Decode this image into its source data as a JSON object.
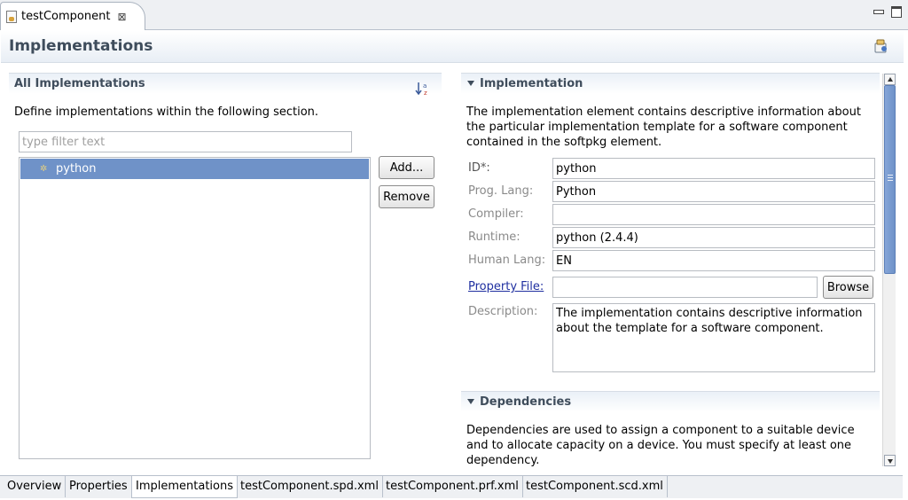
{
  "editor": {
    "tab_title": "testComponent",
    "close_glyph": "⊠"
  },
  "header": {
    "title": "Implementations"
  },
  "left": {
    "section_title": "All Implementations",
    "description": "Define implementations within the following section.",
    "filter_placeholder": "type filter text",
    "filter_value": "",
    "items": [
      {
        "label": "python",
        "icon": "gear-icon",
        "selected": true
      }
    ],
    "add_label": "Add...",
    "remove_label": "Remove"
  },
  "implementation": {
    "section_title": "Implementation",
    "description": "The implementation element contains descriptive information about the particular implementation template for a software component contained in the softpkg element.",
    "fields": {
      "id_label": "ID*:",
      "id_value": "python",
      "prog_lang_label": "Prog. Lang:",
      "prog_lang_value": "Python",
      "compiler_label": "Compiler:",
      "compiler_value": "",
      "runtime_label": "Runtime:",
      "runtime_value": "python (2.4.4)",
      "human_lang_label": "Human Lang:",
      "human_lang_value": "EN",
      "property_file_label": "Property File:",
      "property_file_value": "",
      "browse_label": "Browse",
      "description_label": "Description:",
      "description_value": "The implementation contains descriptive information about the template for a software component."
    }
  },
  "dependencies": {
    "section_title": "Dependencies",
    "description": "Dependencies are used to assign a component to a suitable device and to allocate capacity on a device.  You must specify at least one dependency."
  },
  "page_tabs": [
    {
      "label": "Overview",
      "active": false
    },
    {
      "label": "Properties",
      "active": false
    },
    {
      "label": "Implementations",
      "active": true
    },
    {
      "label": "testComponent.spd.xml",
      "active": false
    },
    {
      "label": "testComponent.prf.xml",
      "active": false
    },
    {
      "label": "testComponent.scd.xml",
      "active": false
    }
  ],
  "colors": {
    "selection": "#6f92c8",
    "section_title": "#3f4d5c",
    "link": "#1f2fa0"
  }
}
